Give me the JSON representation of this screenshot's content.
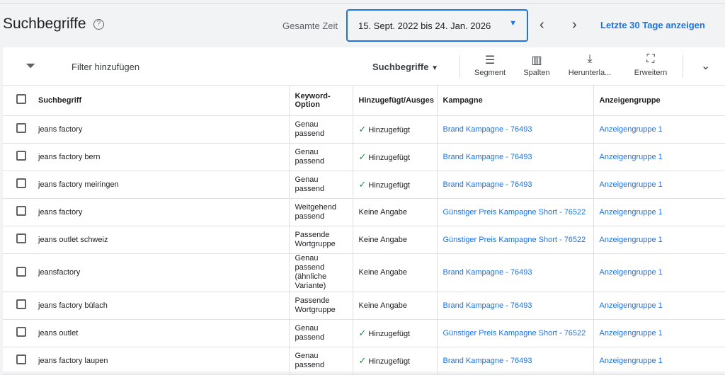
{
  "header": {
    "title": "Suchbegriffe",
    "help_icon": "?",
    "range_label": "Gesamte Zeit",
    "date_range": "15. Sept. 2022 bis 24. Jan. 2026",
    "prev": "‹",
    "next": "›",
    "last30": "Letzte 30 Tage anzeigen"
  },
  "toolbar": {
    "filter": "Filter hinzufügen",
    "view": "Suchbegriffe",
    "segment": "Segment",
    "columns": "Spalten",
    "download": "Herunterla...",
    "expand": "Erweitern"
  },
  "table": {
    "headers": [
      "Suchbegriff",
      "Keyword-Option",
      "Hinzugefügt/Ausges",
      "Kampagne",
      "Anzeigengruppe"
    ],
    "rows": [
      {
        "term": "jeans factory",
        "option": "Genau passend",
        "status": "Hinzugefügt",
        "added": true,
        "campaign": "Brand Kampagne - 76493",
        "group": "Anzeigengruppe 1"
      },
      {
        "term": "jeans factory bern",
        "option": "Genau passend",
        "status": "Hinzugefügt",
        "added": true,
        "campaign": "Brand Kampagne - 76493",
        "group": "Anzeigengruppe 1"
      },
      {
        "term": "jeans factory meiringen",
        "option": "Genau passend",
        "status": "Hinzugefügt",
        "added": true,
        "campaign": "Brand Kampagne - 76493",
        "group": "Anzeigengruppe 1"
      },
      {
        "term": "jeans factory",
        "option": "Weitgehend passend",
        "status": "Keine Angabe",
        "added": false,
        "campaign": "Günstiger Preis Kampagne Short - 76522",
        "group": "Anzeigengruppe 1"
      },
      {
        "term": "jeans outlet schweiz",
        "option": "Passende Wortgruppe",
        "status": "Keine Angabe",
        "added": false,
        "campaign": "Günstiger Preis Kampagne Short - 76522",
        "group": "Anzeigengruppe 1"
      },
      {
        "term": "jeansfactory",
        "option": "Genau passend (ähnliche Variante)",
        "status": "Keine Angabe",
        "added": false,
        "campaign": "Brand Kampagne - 76493",
        "group": "Anzeigengruppe 1"
      },
      {
        "term": "jeans factory bülach",
        "option": "Passende Wortgruppe",
        "status": "Keine Angabe",
        "added": false,
        "campaign": "Brand Kampagne - 76493",
        "group": "Anzeigengruppe 1"
      },
      {
        "term": "jeans outlet",
        "option": "Genau passend",
        "status": "Hinzugefügt",
        "added": true,
        "campaign": "Günstiger Preis Kampagne Short - 76522",
        "group": "Anzeigengruppe 1"
      },
      {
        "term": "jeans factory laupen",
        "option": "Genau passend",
        "status": "Hinzugefügt",
        "added": true,
        "campaign": "Brand Kampagne - 76493",
        "group": "Anzeigengruppe 1"
      }
    ]
  }
}
